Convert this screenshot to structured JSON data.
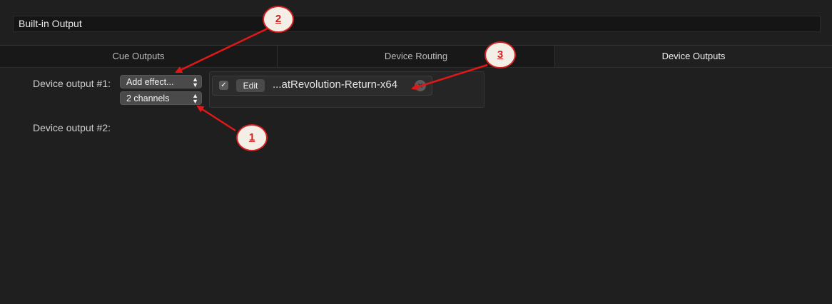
{
  "device": {
    "name": "Built-in Output"
  },
  "tabs": [
    {
      "label": "Cue Outputs",
      "active": false
    },
    {
      "label": "Device Routing",
      "active": false
    },
    {
      "label": "Device Outputs",
      "active": true
    }
  ],
  "outputs": [
    {
      "label": "Device output #1:",
      "add_effect": "Add effect...",
      "channels": "2 channels",
      "effect": {
        "checked": true,
        "edit_label": "Edit",
        "name": "...atRevolution-Return-x64"
      }
    },
    {
      "label": "Device output #2:"
    }
  ],
  "callouts": [
    "1",
    "2",
    "3"
  ],
  "colors": {
    "background": "#1f1f1f",
    "callout": "#d62020",
    "arrow": "#e01818"
  }
}
